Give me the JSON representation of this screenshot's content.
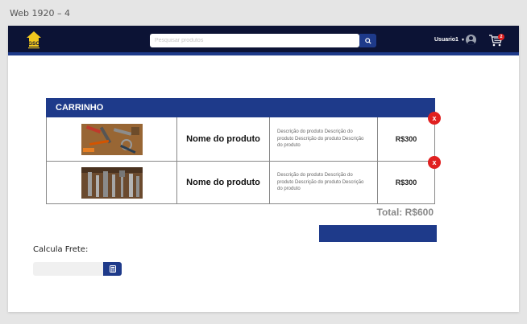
{
  "frame_label": "Web 1920 – 4",
  "header": {
    "logo_text": "GSC",
    "search": {
      "placeholder": "Pesquisar produtos",
      "value": ""
    },
    "user_name": "Usuario1",
    "cart_count": "2"
  },
  "cart": {
    "title": "CARRINHO",
    "items": [
      {
        "name": "Nome do produto",
        "description": "Descrição do produto Descrição do produto Descrição do produto Descrição do produto",
        "price": "R$300",
        "image": "tools-on-wood"
      },
      {
        "name": "Nome do produto",
        "description": "Descrição do produto Descrição do produto Descrição do produto Descrição do produto",
        "price": "R$300",
        "image": "hand-tools-row"
      }
    ],
    "remove_label": "x",
    "total": "Total: R$600"
  },
  "shipping": {
    "label": "Calcula Frete:",
    "input_value": ""
  },
  "colors": {
    "navy": "#0c1335",
    "brand_blue": "#1e3a8a",
    "danger": "#e02020"
  },
  "icons": [
    "logo-icon",
    "search-icon",
    "avatar-icon",
    "cart-icon",
    "remove-icon",
    "calculator-icon"
  ]
}
